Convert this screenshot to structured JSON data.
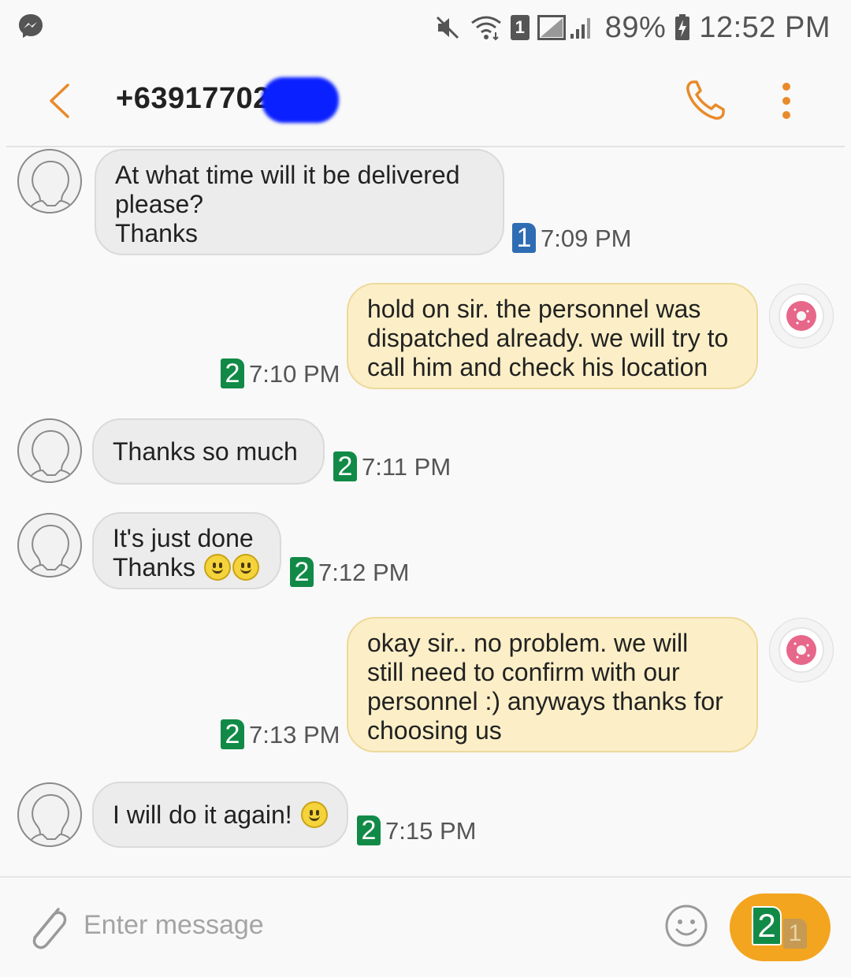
{
  "status_bar": {
    "app_icon": "messenger-icon",
    "sim_slot": "1",
    "battery": "89%",
    "time": "12:52 PM"
  },
  "header": {
    "contact": "+63917702"
  },
  "messages": [
    {
      "direction": "incoming",
      "lines": [
        "At what time will it be delivered",
        "please?",
        "Thanks"
      ],
      "sim": "1",
      "time": "7:09 PM"
    },
    {
      "direction": "outgoing",
      "lines": [
        "hold on sir. the personnel was",
        "dispatched already. we will try to",
        "call him and check his location"
      ],
      "sim": "2",
      "time": "7:10 PM"
    },
    {
      "direction": "incoming",
      "lines": [
        "Thanks so much"
      ],
      "sim": "2",
      "time": "7:11 PM"
    },
    {
      "direction": "incoming",
      "lines": [
        "It's just done",
        "Thanks"
      ],
      "sim": "2",
      "time": "7:12 PM"
    },
    {
      "direction": "outgoing",
      "lines": [
        "okay sir.. no problem. we will",
        "still need to confirm with our",
        "personnel :) anyways thanks for",
        "choosing us"
      ],
      "sim": "2",
      "time": "7:13 PM"
    },
    {
      "direction": "incoming",
      "lines": [
        "I will do it again!"
      ],
      "sim": "2",
      "time": "7:15 PM"
    }
  ],
  "composer": {
    "placeholder": "Enter message",
    "send_sim_front": "2",
    "send_sim_back": "1"
  },
  "colors": {
    "accent": "#e98a2b",
    "incoming_bubble": "#ececec",
    "outgoing_bubble": "#fcefc7",
    "sim1": "#2e6db4",
    "sim2": "#128a47",
    "send_button": "#f3a51f"
  }
}
